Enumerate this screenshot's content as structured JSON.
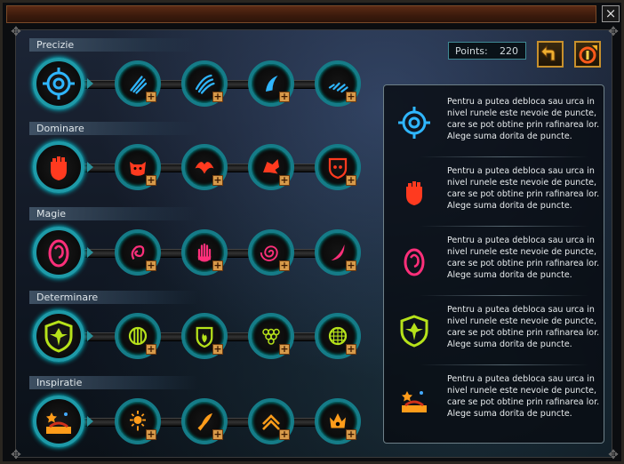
{
  "window": {
    "close_glyph": "×"
  },
  "points": {
    "label": "Points:",
    "value": "220"
  },
  "buttons": {
    "back_icon": "back-arrow-icon",
    "reset_icon": "reset-points-icon"
  },
  "categories": [
    {
      "name": "Precizie",
      "color": "#2fb6ff",
      "main_icon": "target-icon",
      "sub_icons": [
        "claw-scratch-icon",
        "triple-claw-icon",
        "crescent-slash-icon",
        "multi-slash-icon"
      ]
    },
    {
      "name": "Dominare",
      "color": "#ff3a1f",
      "main_icon": "raised-fist-icon",
      "sub_icons": [
        "demon-mask-icon",
        "phoenix-icon",
        "dragon-head-icon",
        "skull-shield-icon"
      ]
    },
    {
      "name": "Magie",
      "color": "#ff2f7a",
      "main_icon": "magic-orb-icon",
      "sub_icons": [
        "flame-swirl-icon",
        "magic-hand-icon",
        "vortex-icon",
        "crescent-icon"
      ]
    },
    {
      "name": "Determinare",
      "color": "#b6e21a",
      "main_icon": "shield-cross-icon",
      "sub_icons": [
        "ribbed-orb-icon",
        "flame-shield-icon",
        "scale-armor-icon",
        "mesh-orb-icon"
      ]
    },
    {
      "name": "Inspiratie",
      "color": "#ff9c1a",
      "main_icon": "spellbook-icon",
      "sub_icons": [
        "sun-burst-icon",
        "horn-icon",
        "chevron-rank-icon",
        "crown-helm-icon"
      ]
    }
  ],
  "info_panel": {
    "entries": [
      {
        "icon": "target-icon",
        "text": "Pentru a putea debloca sau urca in nivel runele este nevoie de puncte, care se pot obtine prin rafinarea lor. Alege suma dorita de puncte."
      },
      {
        "icon": "raised-fist-icon",
        "text": "Pentru a putea debloca sau urca in nivel runele este nevoie de puncte, care se pot obtine prin rafinarea lor. Alege suma dorita de puncte."
      },
      {
        "icon": "magic-orb-icon",
        "text": "Pentru a putea debloca sau urca in nivel runele este nevoie de puncte, care se pot obtine prin rafinarea lor. Alege suma dorita de puncte."
      },
      {
        "icon": "shield-cross-icon",
        "text": "Pentru a putea debloca sau urca in nivel runele este nevoie de puncte, care se pot obtine prin rafinarea lor. Alege suma dorita de puncte."
      },
      {
        "icon": "spellbook-icon",
        "text": "Pentru a putea debloca sau urca in nivel runele este nevoie de puncte, care se pot obtine prin rafinarea lor. Alege suma dorita de puncte."
      }
    ]
  },
  "colors": {
    "ring": "#1e9aa8",
    "accent_gold": "#c8902c",
    "titlebar": "#4a2412"
  }
}
